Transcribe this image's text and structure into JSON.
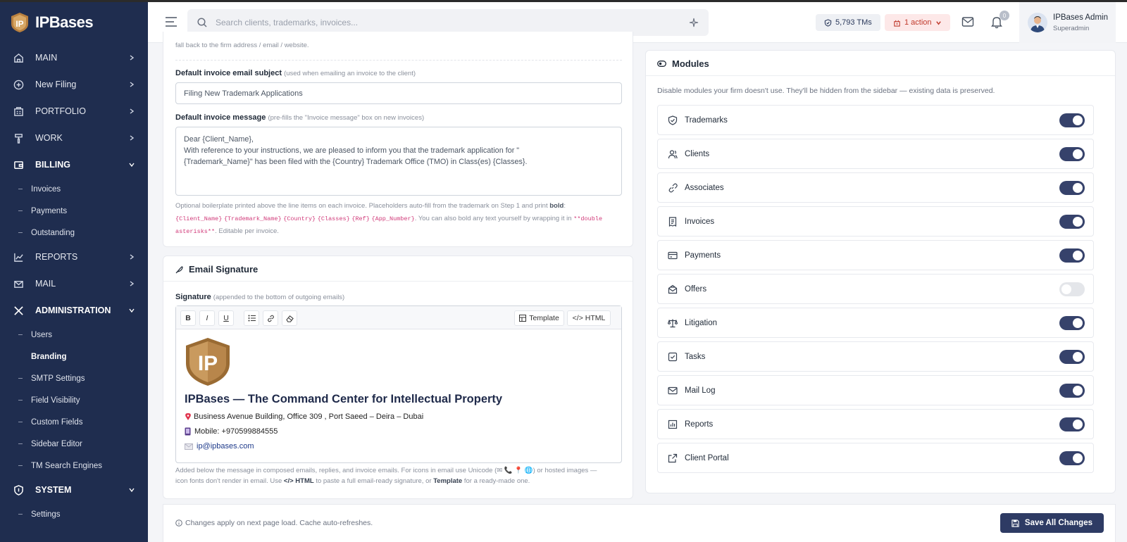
{
  "app": {
    "name": "IPBases"
  },
  "sidebar": {
    "main": "MAIN",
    "new_filing": "New Filing",
    "portfolio": "PORTFOLIO",
    "work": "WORK",
    "billing": "BILLING",
    "billing_items": [
      "Invoices",
      "Payments",
      "Outstanding"
    ],
    "reports": "REPORTS",
    "mail": "MAIL",
    "administration": "ADMINISTRATION",
    "admin_items": [
      "Users",
      "Branding",
      "SMTP Settings",
      "Field Visibility",
      "Custom Fields",
      "Sidebar Editor",
      "TM Search Engines"
    ],
    "system": "SYSTEM",
    "system_items": [
      "Settings"
    ]
  },
  "topbar": {
    "search_placeholder": "Search clients, trademarks, invoices...",
    "tms": "5,793 TMs",
    "action": "1 action",
    "bell_count": "0",
    "user_name": "IPBases Admin",
    "user_role": "Superadmin"
  },
  "invoice": {
    "truncated_text": "fall back to the firm address / email / website.",
    "subject_label": "Default invoice email subject",
    "subject_hint": "(used when emailing an invoice to the client)",
    "subject_value": "Filing New Trademark Applications",
    "message_label": "Default invoice message",
    "message_hint": "(pre-fills the \"Invoice message\" box on new invoices)",
    "message_value": "Dear {Client_Name},\nWith reference to your instructions, we are pleased to inform you that the trademark application for \"\n{Trademark_Name}\" has been filed with the {Country} Trademark Office (TMO) in Class(es) {Classes}.",
    "help_1": "Optional boilerplate printed above the line items on each invoice. Placeholders auto-fill from the trademark on Step 1 and print",
    "help_bold": "bold",
    "help_colon": ":",
    "placeholders": [
      "{Client_Name}",
      "{Trademark_Name}",
      "{Country}",
      "{Classes}",
      "{Ref}",
      "{App_Number}"
    ],
    "help_2": ". You can also bold any text yourself by wrapping it in",
    "code_double_1": "**double",
    "code_double_2": "asterisks**",
    "help_3": ". Editable per invoice."
  },
  "signature": {
    "title": "Email Signature",
    "label": "Signature",
    "hint": "(appended to the bottom of outgoing emails)",
    "toolbar": {
      "bold": "B",
      "italic": "I",
      "underline": "U",
      "template": "Template",
      "html": "</> HTML"
    },
    "logo_text": "IP",
    "heading": "IPBases — The Command Center for Intellectual Property",
    "address": "Business Avenue Building, Office 309 , Port Saeed – Deira – Dubai",
    "mobile": "Mobile: +970599884555",
    "email": "ip@ipbases.com",
    "help_1": "Added below the message in composed emails, replies, and invoice emails. For icons in email use Unicode (✉ 📞 📍 🌐) or hosted images —",
    "help_2": "icon fonts don't render in email. Use",
    "help_html": "</> HTML",
    "help_3": "to paste a full email-ready signature, or",
    "help_template": "Template",
    "help_4": "for a ready-made one."
  },
  "modules": {
    "title": "Modules",
    "description": "Disable modules your firm doesn't use. They'll be hidden from the sidebar — existing data is preserved.",
    "items": [
      {
        "label": "Trademarks",
        "icon": "shield-check-icon",
        "enabled": true
      },
      {
        "label": "Clients",
        "icon": "users-icon",
        "enabled": true
      },
      {
        "label": "Associates",
        "icon": "link-icon",
        "enabled": true
      },
      {
        "label": "Invoices",
        "icon": "receipt-icon",
        "enabled": true
      },
      {
        "label": "Payments",
        "icon": "credit-card-icon",
        "enabled": true
      },
      {
        "label": "Offers",
        "icon": "mail-open-icon",
        "enabled": false
      },
      {
        "label": "Litigation",
        "icon": "scale-icon",
        "enabled": true
      },
      {
        "label": "Tasks",
        "icon": "check-square-icon",
        "enabled": true
      },
      {
        "label": "Mail Log",
        "icon": "mail-icon",
        "enabled": true
      },
      {
        "label": "Reports",
        "icon": "bar-chart-icon",
        "enabled": true
      },
      {
        "label": "Client Portal",
        "icon": "external-link-icon",
        "enabled": true
      }
    ]
  },
  "footer": {
    "note": "Changes apply on next page load. Cache auto-refreshes.",
    "save_label": "Save All Changes"
  },
  "colors": {
    "sidebar": "#1f2d4f",
    "accent": "#36426b",
    "brand_gold": "#a97a3f"
  }
}
